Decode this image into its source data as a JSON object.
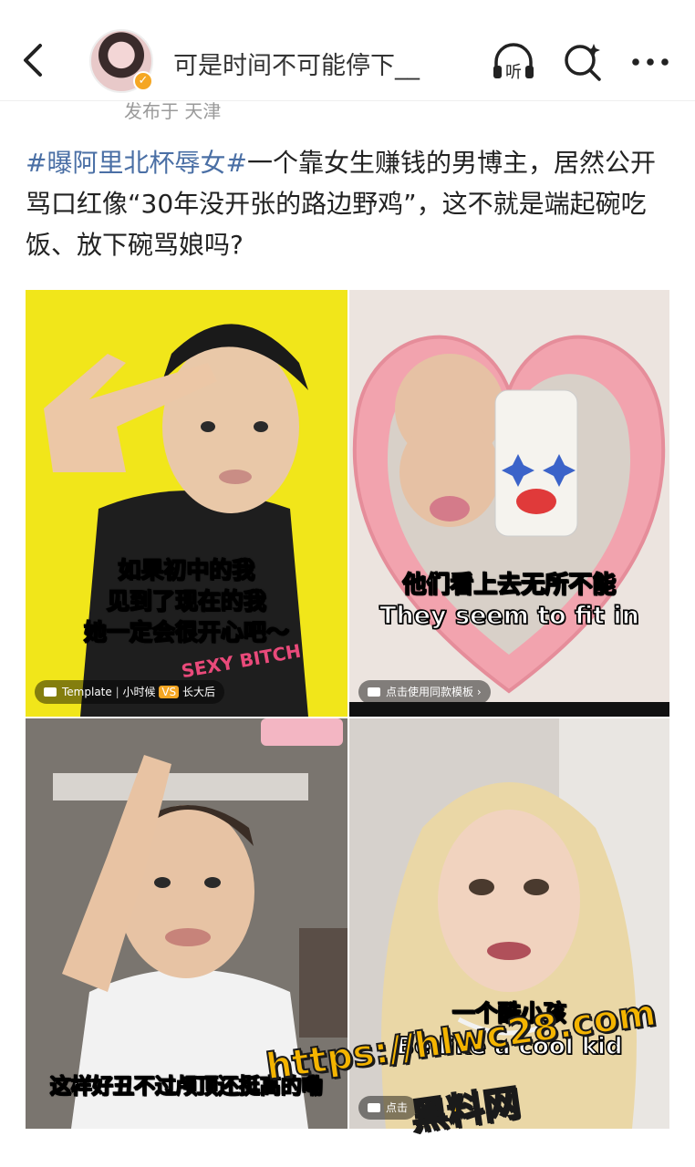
{
  "header": {
    "username": "可是时间不可能停下__",
    "location": "发布于 天津",
    "listen_label": "听"
  },
  "icons": {
    "back": "chevron-left-icon",
    "listen": "headphones-icon",
    "search": "search-icon",
    "more": "more-dots-icon",
    "verified": "verified-badge-icon"
  },
  "post": {
    "hashtag": "#曝阿里北杯辱女#",
    "body": "一个靠女生赚钱的男博主，居然公开骂口红像“30年没开张的路边野鸡”，这不就是端起碗吃饭、放下碗骂娘吗?"
  },
  "images": [
    {
      "caption_lines": [
        "如果初中的我",
        "见到了现在的我",
        "她一定会很开心吧～"
      ],
      "shirt_text": "SEXY BITCH",
      "template_label": "Template",
      "template_tags": [
        "小时候",
        "VS",
        "长大后"
      ]
    },
    {
      "caption_cn": "他们看上去无所不能",
      "caption_en": "They seem to fit in",
      "template_label": "点击使用同款模板"
    },
    {
      "caption_cn": "这样好丑不过颅顶还挺高的嘞"
    },
    {
      "caption_cn": "一个酷小孩",
      "caption_en": "Be like a cool kid",
      "template_label": "点击"
    }
  ],
  "watermark": {
    "url": "https://hlwc28.com",
    "site": "黑料网"
  },
  "colors": {
    "hashtag": "#4a6fa5",
    "verified": "#f5a623",
    "watermark": "#f4b400",
    "tile1_bg": "#f1e61a"
  }
}
